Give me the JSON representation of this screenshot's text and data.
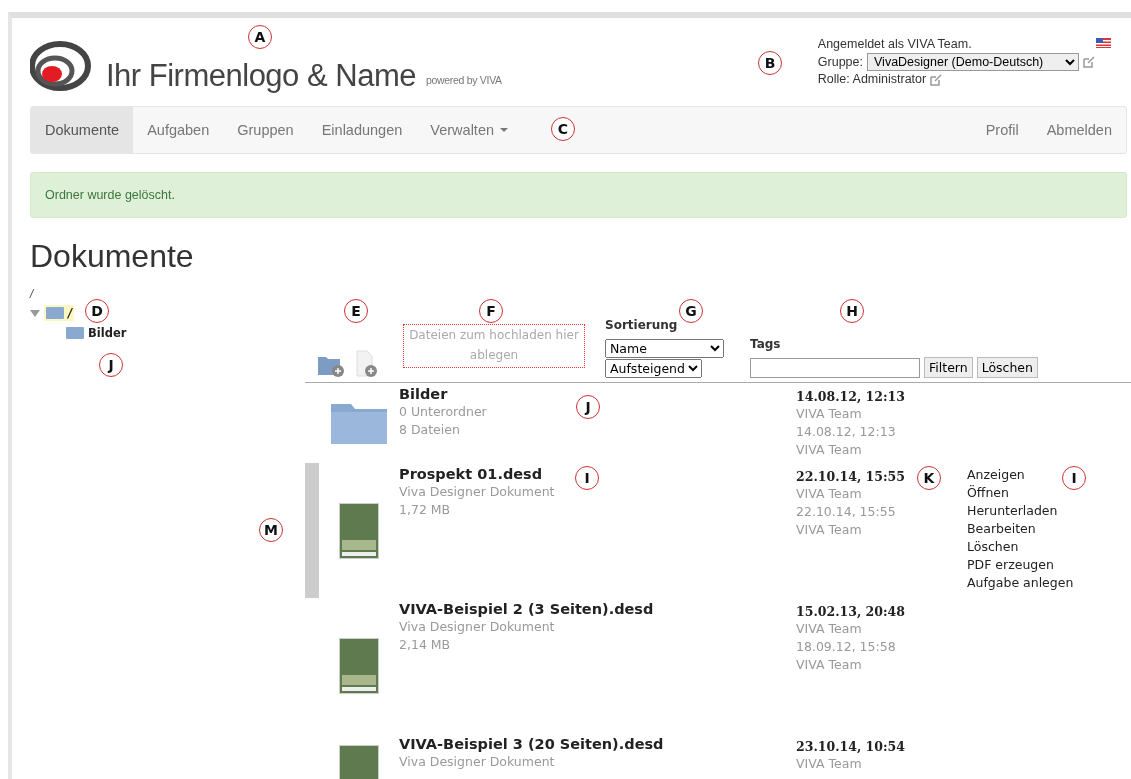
{
  "header": {
    "brand": "Ihr Firmenlogo & Name",
    "powered": "powered by VIVA",
    "login": "Angemeldet als VIVA Team.",
    "group_label": "Gruppe:",
    "group_value": "VivaDesigner (Demo-Deutsch)",
    "role": "Rolle: Administrator"
  },
  "nav": {
    "left": [
      {
        "label": "Dokumente",
        "selected": true,
        "dropdown": false
      },
      {
        "label": "Aufgaben",
        "selected": false,
        "dropdown": false
      },
      {
        "label": "Gruppen",
        "selected": false,
        "dropdown": false
      },
      {
        "label": "Einladungen",
        "selected": false,
        "dropdown": false
      },
      {
        "label": "Verwalten",
        "selected": false,
        "dropdown": true
      }
    ],
    "right": [
      "Profil",
      "Abmelden"
    ]
  },
  "alert": "Ordner wurde gelöscht.",
  "heading": "Dokumente",
  "breadcrumb": "/",
  "tree": {
    "label": "/",
    "expanded": true,
    "selected": true,
    "children": [
      {
        "label": "Bilder",
        "selected": false
      }
    ]
  },
  "toolbar": {
    "dropzone": "Dateien zum hochladen hier ablegen",
    "sort_label": "Sortierung",
    "sort_field": "Name",
    "sort_order": "Aufsteigend",
    "tags_label": "Tags",
    "filter_button": "Filtern",
    "clear_button": "Löschen"
  },
  "rows": [
    {
      "kind": "folder",
      "selected": false,
      "name": "Bilder",
      "meta": [
        "0 Unterordner",
        "8 Dateien"
      ],
      "created": "14.08.12, 12:13",
      "created_by": "VIVA Team",
      "modified": "14.08.12, 12:13",
      "modified_by": "VIVA Team",
      "actions": []
    },
    {
      "kind": "document",
      "selected": true,
      "name": "Prospekt 01.desd",
      "meta": [
        "Viva Designer Dokument",
        "1,72 MB"
      ],
      "created": "22.10.14, 15:55",
      "created_by": "VIVA Team",
      "modified": "22.10.14, 15:55",
      "modified_by": "VIVA Team",
      "actions": [
        "Anzeigen",
        "Öffnen",
        "Herunterladen",
        "Bearbeiten",
        "Löschen",
        "PDF erzeugen",
        "Aufgabe anlegen"
      ]
    },
    {
      "kind": "document",
      "selected": false,
      "name": "VIVA-Beispiel 2 (3 Seiten).desd",
      "meta": [
        "Viva Designer Dokument",
        "2,14 MB"
      ],
      "created": "15.02.13, 20:48",
      "created_by": "VIVA Team",
      "modified": "18.09.12, 15:58",
      "modified_by": "VIVA Team",
      "actions": []
    },
    {
      "kind": "document",
      "selected": false,
      "name": "VIVA-Beispiel 3 (20 Seiten).desd",
      "meta": [
        "Viva Designer Dokument"
      ],
      "created": "23.10.14, 10:54",
      "created_by": "VIVA Team",
      "actions": []
    }
  ],
  "callouts": [
    "A",
    "B",
    "C",
    "D",
    "E",
    "F",
    "G",
    "H",
    "J",
    "J",
    "I",
    "K",
    "I",
    "M"
  ]
}
